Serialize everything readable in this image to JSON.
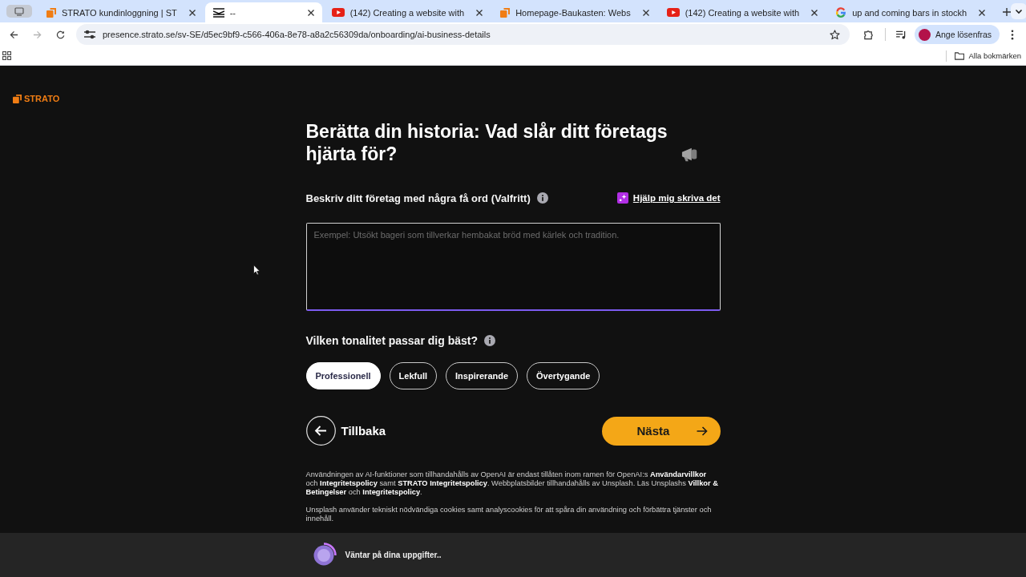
{
  "browser": {
    "tabs": [
      {
        "title": "STRATO kundinloggning | ST",
        "kind": "strato",
        "selected": false
      },
      {
        "title": "--",
        "kind": "page",
        "selected": true
      },
      {
        "title": "(142) Creating a website with",
        "kind": "youtube",
        "selected": false
      },
      {
        "title": "Homepage-Baukasten: Webs",
        "kind": "strato",
        "selected": false
      },
      {
        "title": "(142) Creating a website with",
        "kind": "youtube",
        "selected": false
      },
      {
        "title": "up and coming bars in stockh",
        "kind": "google",
        "selected": false
      }
    ],
    "nav": {
      "forward_disabled": true
    },
    "url": "presence.strato.se/sv-SE/d5ec9bf9-c566-406a-8e78-a8a2c56309da/onboarding/ai-business-details",
    "profile": "Ange lösenfras",
    "bookmarks_folder": "Alla bokmärken"
  },
  "page": {
    "logo": "STRATO",
    "heading": "Berätta din historia: Vad slår ditt företags hjärta för?",
    "description": {
      "label": "Beskriv ditt företag med några få ord (Valfritt)",
      "help_link": "Hjälp mig skriva det",
      "placeholder": "Exempel: Utsökt bageri som tillverkar hembakat bröd med kärlek och tradition."
    },
    "tone": {
      "label": "Vilken tonalitet passar dig bäst?",
      "options": [
        {
          "label": "Professionell",
          "selected": true
        },
        {
          "label": "Lekfull",
          "selected": false
        },
        {
          "label": "Inspirerande",
          "selected": false
        },
        {
          "label": "Övertygande",
          "selected": false
        }
      ]
    },
    "back": "Tillbaka",
    "next": "Nästa",
    "legal": [
      "Användningen av AI-funktioner som tillhandahålls av OpenAI är endast tillåten inom ramen för OpenAI:s **Användarvillkor** och **Integritetspolicy** samt **STRATO Integritetspolicy**. Webbplatsbilder tillhandahålls av Unsplash. Läs Unsplashs **Villkor & Betingelser** och **Integritetspolicy**.",
      "Unsplash använder tekniskt nödvändiga cookies samt analyscookies för att spåra din användning och förbättra tjänster och innehåll."
    ]
  },
  "status_bar": {
    "text": "Väntar på dina uppgifter.."
  }
}
